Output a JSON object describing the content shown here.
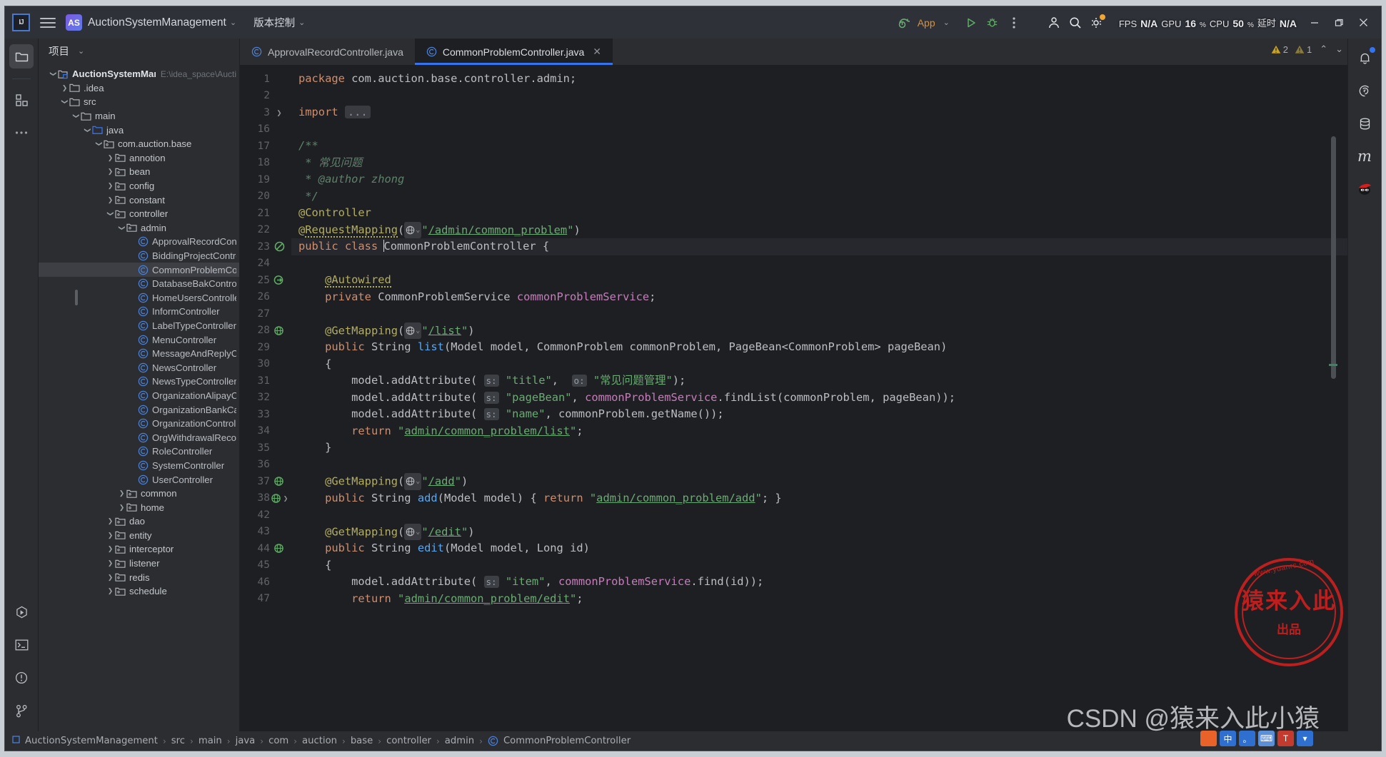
{
  "titlebar": {
    "logo_text": "IJ",
    "project_badge": "AS",
    "project_name": "AuctionSystemManagement",
    "vcs_label": "版本控制",
    "run_config": "App",
    "perf": {
      "fps_label": "FPS",
      "fps_value": "N/A",
      "gpu_label": "GPU",
      "gpu_value": "16",
      "gpu_unit": "%",
      "cpu_label": "CPU",
      "cpu_value": "50",
      "cpu_unit": "%",
      "latency_label": "延时",
      "latency_value": "N/A"
    }
  },
  "left_rail": {
    "items": [
      {
        "name": "project-icon",
        "active": true
      },
      {
        "name": "structure-icon",
        "active": false
      },
      {
        "name": "more-tool-windows-icon",
        "active": false
      }
    ],
    "bottom_items": [
      {
        "name": "run-icon"
      },
      {
        "name": "terminal-icon"
      },
      {
        "name": "problems-icon"
      },
      {
        "name": "version-control-icon"
      }
    ]
  },
  "project_panel": {
    "title": "项目",
    "tree": [
      {
        "indent": 0,
        "arrow": "down",
        "icon": "module",
        "label": "AuctionSystemManagement",
        "sub": "E:\\idea_space\\Aucti",
        "bold": true
      },
      {
        "indent": 1,
        "arrow": "right",
        "icon": "folder",
        "label": ".idea"
      },
      {
        "indent": 1,
        "arrow": "down",
        "icon": "folder",
        "label": "src"
      },
      {
        "indent": 2,
        "arrow": "down",
        "icon": "folder",
        "label": "main"
      },
      {
        "indent": 3,
        "arrow": "down",
        "icon": "source",
        "label": "java"
      },
      {
        "indent": 4,
        "arrow": "down",
        "icon": "package",
        "label": "com.auction.base"
      },
      {
        "indent": 5,
        "arrow": "right",
        "icon": "package",
        "label": "annotion"
      },
      {
        "indent": 5,
        "arrow": "right",
        "icon": "package",
        "label": "bean"
      },
      {
        "indent": 5,
        "arrow": "right",
        "icon": "package",
        "label": "config"
      },
      {
        "indent": 5,
        "arrow": "right",
        "icon": "package",
        "label": "constant"
      },
      {
        "indent": 5,
        "arrow": "down",
        "icon": "package",
        "label": "controller"
      },
      {
        "indent": 6,
        "arrow": "down",
        "icon": "package",
        "label": "admin"
      },
      {
        "indent": 7,
        "arrow": "none",
        "icon": "class",
        "label": "ApprovalRecordController"
      },
      {
        "indent": 7,
        "arrow": "none",
        "icon": "class",
        "label": "BiddingProjectController"
      },
      {
        "indent": 7,
        "arrow": "none",
        "icon": "class",
        "label": "CommonProblemController",
        "selected": true
      },
      {
        "indent": 7,
        "arrow": "none",
        "icon": "class",
        "label": "DatabaseBakController"
      },
      {
        "indent": 7,
        "arrow": "none",
        "icon": "class",
        "label": "HomeUsersController"
      },
      {
        "indent": 7,
        "arrow": "none",
        "icon": "class",
        "label": "InformController"
      },
      {
        "indent": 7,
        "arrow": "none",
        "icon": "class",
        "label": "LabelTypeController"
      },
      {
        "indent": 7,
        "arrow": "none",
        "icon": "class",
        "label": "MenuController"
      },
      {
        "indent": 7,
        "arrow": "none",
        "icon": "class",
        "label": "MessageAndReplyController"
      },
      {
        "indent": 7,
        "arrow": "none",
        "icon": "class",
        "label": "NewsController"
      },
      {
        "indent": 7,
        "arrow": "none",
        "icon": "class",
        "label": "NewsTypeController"
      },
      {
        "indent": 7,
        "arrow": "none",
        "icon": "class",
        "label": "OrganizationAlipayController"
      },
      {
        "indent": 7,
        "arrow": "none",
        "icon": "class",
        "label": "OrganizationBankCardController"
      },
      {
        "indent": 7,
        "arrow": "none",
        "icon": "class",
        "label": "OrganizationController"
      },
      {
        "indent": 7,
        "arrow": "none",
        "icon": "class",
        "label": "OrgWithdrawalRecordController"
      },
      {
        "indent": 7,
        "arrow": "none",
        "icon": "class",
        "label": "RoleController"
      },
      {
        "indent": 7,
        "arrow": "none",
        "icon": "class",
        "label": "SystemController"
      },
      {
        "indent": 7,
        "arrow": "none",
        "icon": "class",
        "label": "UserController"
      },
      {
        "indent": 6,
        "arrow": "right",
        "icon": "package",
        "label": "common"
      },
      {
        "indent": 6,
        "arrow": "right",
        "icon": "package",
        "label": "home"
      },
      {
        "indent": 5,
        "arrow": "right",
        "icon": "package",
        "label": "dao"
      },
      {
        "indent": 5,
        "arrow": "right",
        "icon": "package",
        "label": "entity"
      },
      {
        "indent": 5,
        "arrow": "right",
        "icon": "package",
        "label": "interceptor"
      },
      {
        "indent": 5,
        "arrow": "right",
        "icon": "package",
        "label": "listener"
      },
      {
        "indent": 5,
        "arrow": "right",
        "icon": "package",
        "label": "redis"
      },
      {
        "indent": 5,
        "arrow": "right",
        "icon": "package",
        "label": "schedule"
      }
    ]
  },
  "editor": {
    "tabs": [
      {
        "label": "ApprovalRecordController.java",
        "active": false,
        "closable": false
      },
      {
        "label": "CommonProblemController.java",
        "active": true,
        "closable": true
      }
    ],
    "inspections": {
      "warnings_major": "2",
      "warnings_minor": "1"
    },
    "line_numbers": [
      "1",
      "2",
      "3",
      "16",
      "17",
      "18",
      "19",
      "20",
      "21",
      "22",
      "23",
      "24",
      "25",
      "26",
      "27",
      "28",
      "29",
      "30",
      "31",
      "32",
      "33",
      "34",
      "35",
      "36",
      "37",
      "38",
      "42",
      "43",
      "44",
      "45",
      "46",
      "47"
    ],
    "code_lines": [
      "package com.auction.base.controller.admin;",
      "",
      "import ...",
      "",
      "/**",
      " * 常见问题",
      " * @author zhong",
      " */",
      "@Controller",
      "@RequestMapping(\"/admin/common_problem\")",
      "public class CommonProblemController {",
      "",
      "    @Autowired",
      "    private CommonProblemService commonProblemService;",
      "",
      "    @GetMapping(\"/list\")",
      "    public String list(Model model, CommonProblem commonProblem, PageBean<CommonProblem> pageBean)",
      "    {",
      "        model.addAttribute( s: \"title\",  o: \"常见问题管理\");",
      "        model.addAttribute( s: \"pageBean\", commonProblemService.findList(commonProblem, pageBean));",
      "        model.addAttribute( s: \"name\", commonProblem.getName());",
      "        return \"admin/common_problem/list\";",
      "    }",
      "",
      "    @GetMapping(\"/add\")",
      "    public String add(Model model) { return \"admin/common_problem/add\"; }",
      "",
      "    @GetMapping(\"/edit\")",
      "    public String edit(Model model, Long id)",
      "    {",
      "        model.addAttribute( s: \"item\", commonProblemService.find(id));",
      "        return \"admin/common_problem/edit\";"
    ],
    "hint_s": "s:",
    "hint_o": "o:",
    "fold_placeholder": "..."
  },
  "right_rail": {
    "items": [
      {
        "name": "notifications-icon"
      },
      {
        "name": "spring-icon"
      },
      {
        "name": "database-icon"
      },
      {
        "name": "maven-icon"
      },
      {
        "name": "ninja-icon"
      }
    ]
  },
  "breadcrumb": {
    "items": [
      "AuctionSystemManagement",
      "src",
      "main",
      "java",
      "com",
      "auction",
      "base",
      "controller",
      "admin",
      "CommonProblemController"
    ],
    "separator": "›"
  },
  "watermarks": {
    "stamp_url": "www.yuanrc.com",
    "stamp_main": "猿来入此",
    "stamp_sub": "出品",
    "csdn": "CSDN @猿来入此小猿"
  },
  "colors": {
    "accent": "#3574f0",
    "panel_bg": "#2b2d30",
    "editor_bg": "#1e1f22",
    "keyword": "#cf8e6d",
    "string": "#6aab73",
    "annotation": "#b3ae60",
    "field": "#c77dbb",
    "method": "#56a8f5",
    "comment": "#5f826b",
    "stamp_red": "#d2201e"
  }
}
